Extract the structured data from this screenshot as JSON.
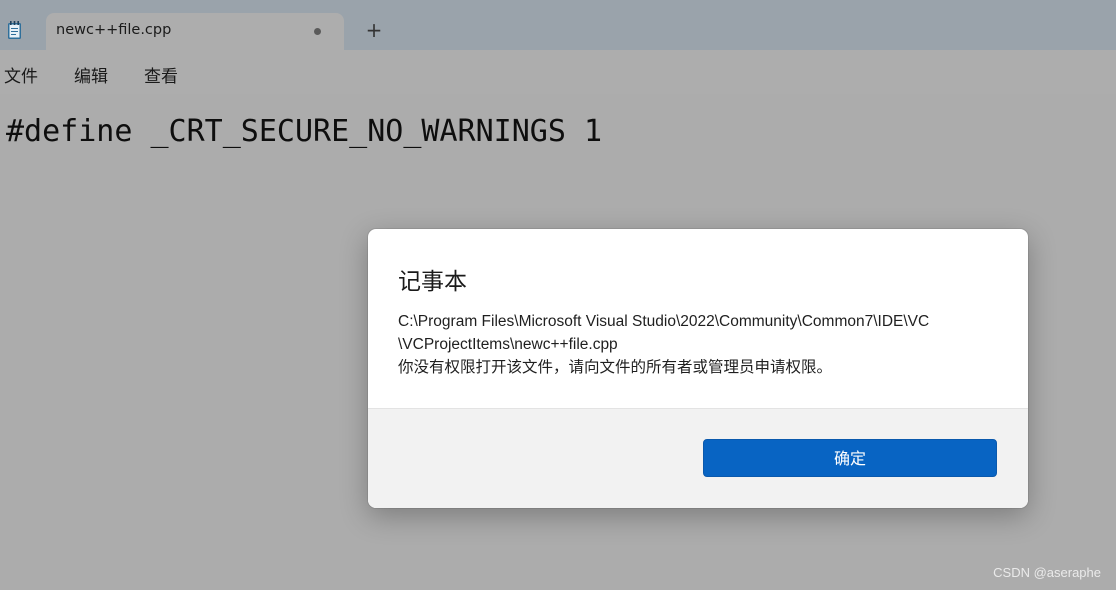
{
  "tab": {
    "title": "newc++file.cpp",
    "new_tab_label": "+"
  },
  "menu": {
    "items": [
      "文件",
      "编辑",
      "查看"
    ]
  },
  "editor": {
    "content": "#define _CRT_SECURE_NO_WARNINGS 1"
  },
  "dialog": {
    "title": "记事本",
    "message_lines": [
      "C:\\Program Files\\Microsoft Visual Studio\\2022\\Community\\Common7\\IDE\\VC",
      "\\VCProjectItems\\newc++file.cpp",
      "你没有权限打开该文件，请向文件的所有者或管理员申请权限。"
    ],
    "ok_label": "确定"
  },
  "watermark": "CSDN @aseraphe",
  "colors": {
    "accent": "#0864c3",
    "tabstrip": "#9aa3ab"
  },
  "icons": {
    "app": "notepad-icon",
    "new_tab": "plus-icon",
    "tab_modified": "unsaved-dot-icon"
  }
}
